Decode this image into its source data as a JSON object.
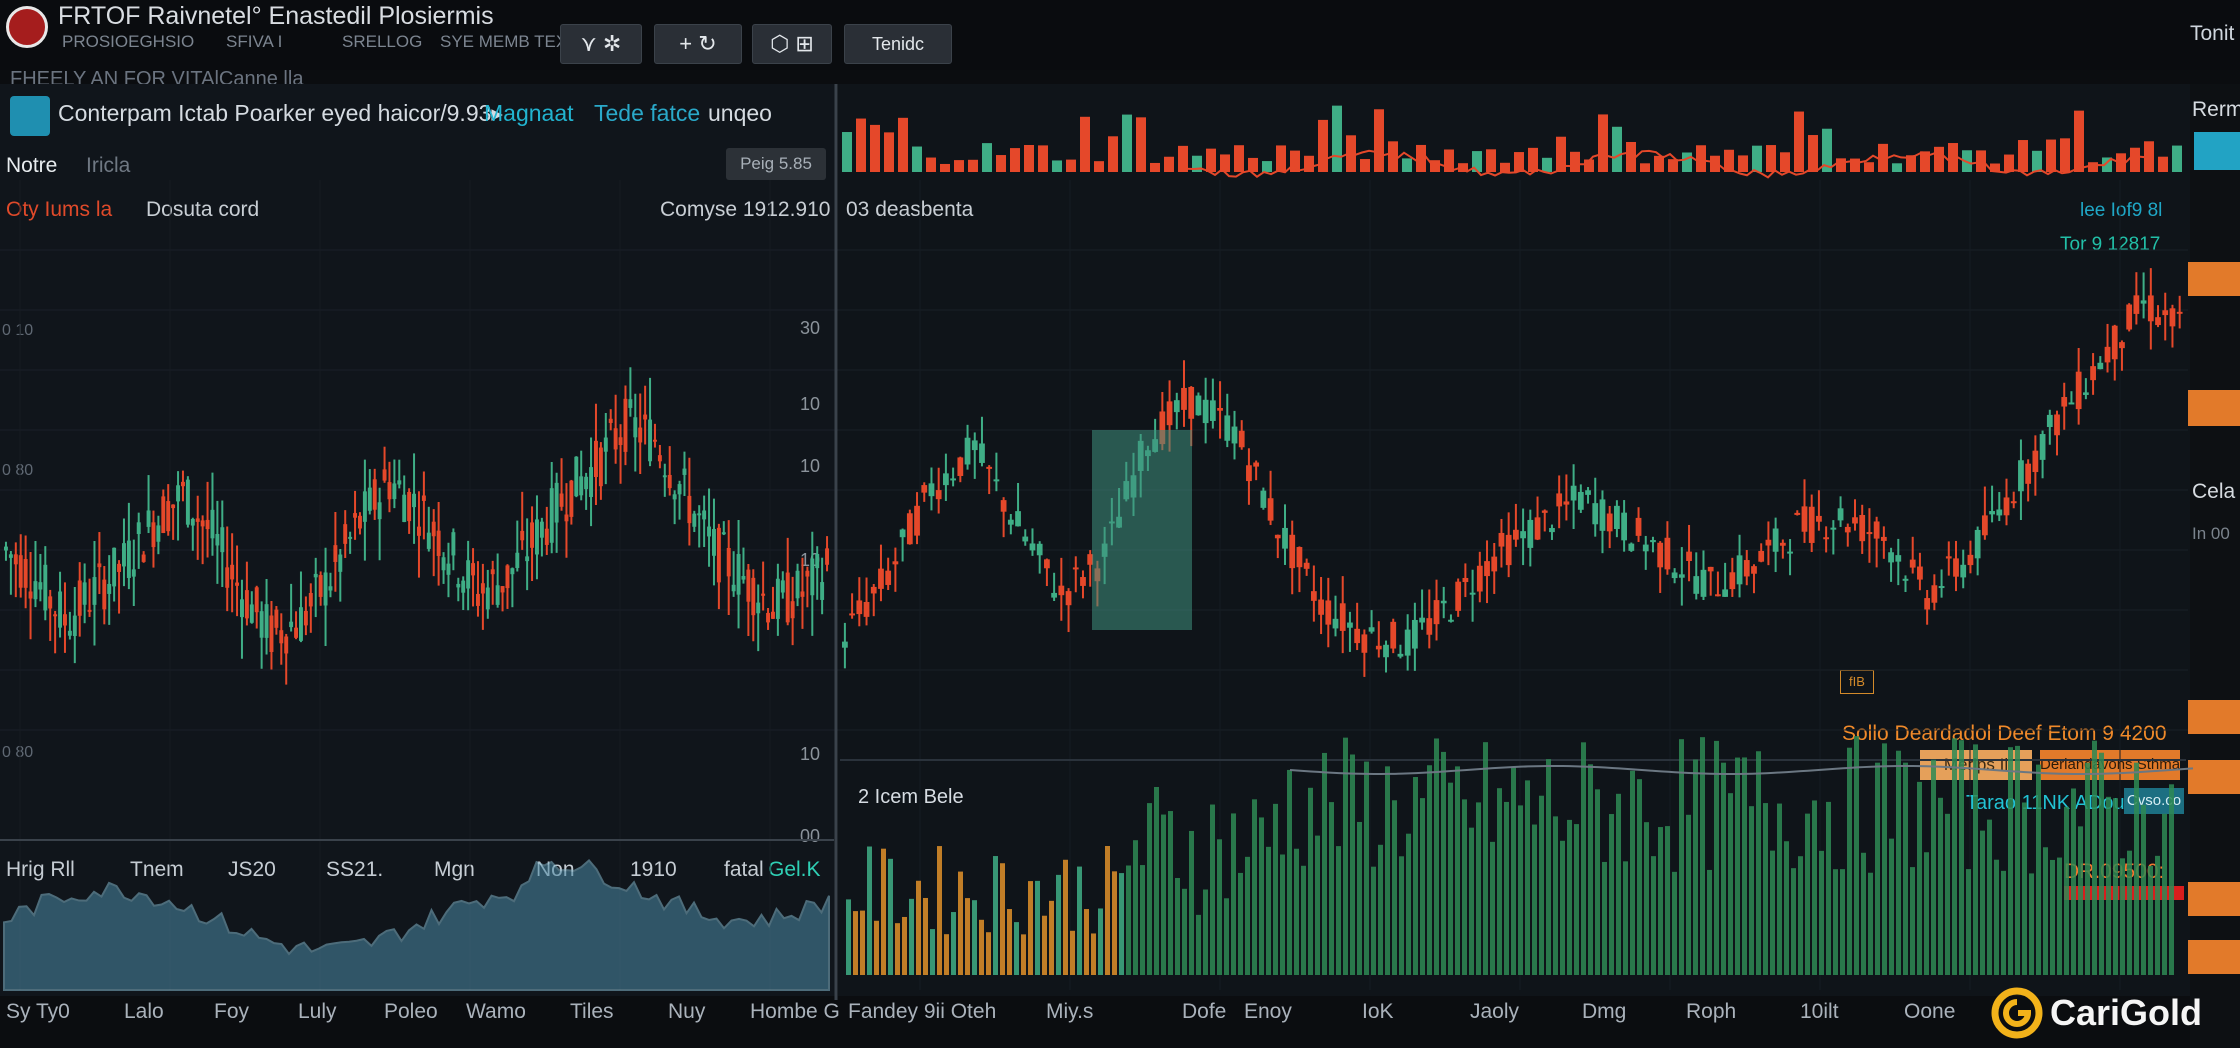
{
  "app": {
    "title": "FRTOF Raivnetel° Enastedil Plosiermis",
    "top_right_label": "Tonit",
    "menu": [
      "PROSIOEGHSIO",
      "SFIVA I",
      "SRELLOG",
      "SYE MEMB TEXT"
    ],
    "toolbar": {
      "btn1": "⋎ ✲",
      "btn2": "+ ↻",
      "btn3": "⬡ ⊞",
      "btn4": "Tenidc"
    },
    "subheader": "FHEELY AN FOR VITAlCanne lla"
  },
  "left_panel": {
    "header_text": "Conterpam Ictab Poarker eyed haicor/9.93▸",
    "header_accent": "Magnaat",
    "header_accent2": "Tede fatce",
    "header_tail": "unqeo",
    "nav_label": "Notre",
    "nav_label2": "Iricla",
    "pill_label": "Peig 5.85",
    "chart_label_red": "Oty Iums la",
    "chart_label": "Dosuta cord",
    "chart_label_right": "Comyse 1912.910",
    "axis_right": [
      "30",
      "10",
      "10",
      "10",
      "10",
      "00"
    ],
    "axis_left": [
      "0 10",
      "0 80",
      "0 80",
      "0 80"
    ],
    "bottom_stats": [
      "Hrig Rll",
      "Tnem",
      "JS20",
      "SS21.",
      "Mgn",
      "Non",
      "1910",
      "fatal",
      "Gel.K"
    ],
    "footer": [
      "Sy Ty0",
      "Lalo",
      "Foy",
      "Luly",
      "Poleo",
      "Wamo",
      "Tiles",
      "Nuy",
      "Hombe G"
    ]
  },
  "right_panel": {
    "chart_label": "03 deasbenta",
    "top_right_small": "lee Iof9 8l",
    "top_right_price": "Tor 9 12817",
    "orange_overlay": "Sollo Deardadol Deef Etom 9 4200",
    "pill_left": "Merlps Il",
    "pill_right": "Derlandavons Sthmas",
    "teal_label": "Tarao 11NK ADou",
    "teal_pill": "Cvso.co",
    "volume_label": "2 Icem Bele",
    "red_price": "DR.09500:",
    "mid_badge": "fIB",
    "footer": [
      "Fandey 9ii Oteh",
      "Miy.s",
      "Dofe",
      "Enoy",
      "IoK",
      "Jaoly",
      "Dmg",
      "Roph",
      "10ilt",
      "Oone"
    ]
  },
  "sidebar_right": {
    "label1": "Rermi",
    "label2": "Cela",
    "label3": "In 00"
  },
  "watermark": {
    "text": "CariGold"
  },
  "colors": {
    "bull": "#3fae86",
    "bear": "#e5482a",
    "accent_orange": "#e27a2a",
    "accent_teal": "#22a3c4",
    "volume_green": "#2e8a55",
    "volume_blue": "#4b8aa5"
  },
  "chart_data": [
    {
      "type": "line",
      "title": "",
      "series": [
        {
          "values": [
            100,
            96,
            90,
            94,
            98,
            104,
            108,
            102,
            94,
            88,
            90,
            96,
            104,
            110,
            106,
            100,
            94,
            96,
            102,
            108,
            112,
            118,
            116,
            108,
            100,
            96,
            92,
            94,
            98
          ]
        }
      ]
    },
    {
      "type": "line",
      "title": "",
      "series": [
        {
          "values": [
            96,
            108,
            126,
            134,
            118,
            104,
            112,
            136,
            144,
            138,
            118,
            102,
            96,
            94,
            102,
            112,
            118,
            124,
            118,
            112,
            106,
            110,
            118,
            120,
            116,
            104,
            112,
            126,
            140,
            152,
            164,
            158
          ]
        }
      ]
    }
  ]
}
